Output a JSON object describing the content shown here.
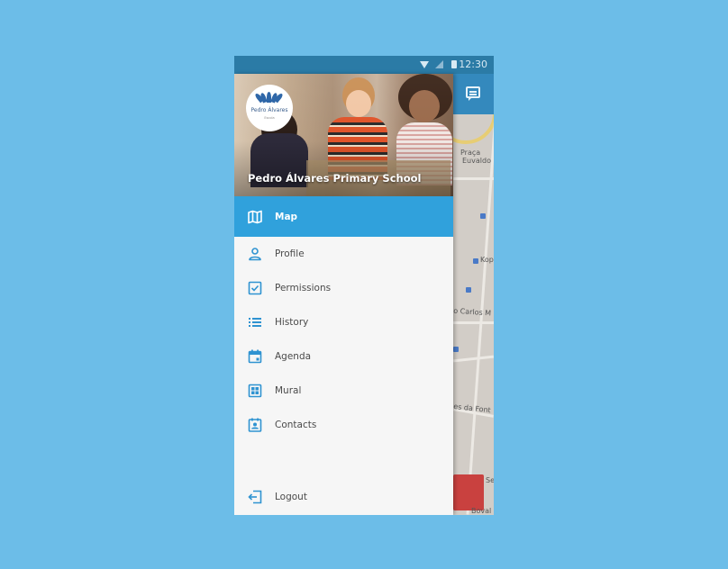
{
  "status_bar": {
    "time": "12:30"
  },
  "header": {
    "logo_name": "Pedro Álvares",
    "logo_subtitle": "Escola",
    "school_name": "Pedro Álvares Primary School"
  },
  "menu": {
    "items": [
      {
        "label": "Map",
        "icon": "map-icon",
        "active": true
      },
      {
        "label": "Profile",
        "icon": "person-icon",
        "active": false
      },
      {
        "label": "Permissions",
        "icon": "checkbox-icon",
        "active": false
      },
      {
        "label": "History",
        "icon": "list-icon",
        "active": false
      },
      {
        "label": "Agenda",
        "icon": "calendar-icon",
        "active": false
      },
      {
        "label": "Mural",
        "icon": "dashboard-icon",
        "active": false
      },
      {
        "label": "Contacts",
        "icon": "contact-card-icon",
        "active": false
      }
    ],
    "logout_label": "Logout"
  },
  "map": {
    "labels": [
      "Praça",
      "Euvaldo L",
      "Kop",
      "lo Carlos M",
      "les da Font",
      "Sei",
      "Boval"
    ]
  },
  "colors": {
    "background": "#6cbde8",
    "status_bar": "#2b7ba6",
    "app_bar": "#3489bd",
    "active_item": "#30a1dc",
    "icon_blue": "#2f93d1",
    "drawer_bg": "#f6f6f6"
  }
}
